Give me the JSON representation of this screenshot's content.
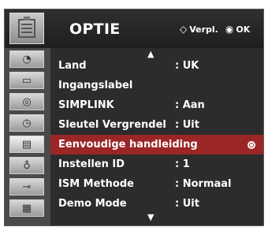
{
  "header": {
    "title": "OPTIE",
    "nav_glyph": "◇",
    "nav_label": "Verpl.",
    "ok_glyph": "◉",
    "ok_label": "OK"
  },
  "sidebar": {
    "header_icon": "option-menu-icon",
    "items": [
      {
        "icon": "satellite-dish-icon",
        "glyph": "◔"
      },
      {
        "icon": "picture-icon",
        "glyph": "▭"
      },
      {
        "icon": "audio-icon",
        "glyph": "◎"
      },
      {
        "icon": "time-icon",
        "glyph": "◷"
      },
      {
        "icon": "option-icon",
        "glyph": "▤"
      },
      {
        "icon": "lock-icon",
        "glyph": "♁"
      },
      {
        "icon": "input-icon",
        "glyph": "⊸"
      },
      {
        "icon": "usb-icon",
        "glyph": "▦"
      }
    ],
    "active_index": 4
  },
  "menu": {
    "items": [
      {
        "label": "Land",
        "value": ": UK"
      },
      {
        "label": "Ingangslabel",
        "value": ""
      },
      {
        "label": "SIMPLINK",
        "value": ": Aan"
      },
      {
        "label": "Sleutel Vergrendel",
        "value": ": Uit"
      },
      {
        "label": "Eenvoudige handleiding",
        "value": ""
      },
      {
        "label": "Instellen ID",
        "value": ": 1"
      },
      {
        "label": "ISM Methode",
        "value": ": Normaal"
      },
      {
        "label": "Demo Mode",
        "value": ": Uit"
      }
    ],
    "selected_index": 4,
    "scroll_up_glyph": "▲",
    "scroll_down_glyph": "▼"
  },
  "colors": {
    "selected_row": "#9a2626",
    "background": "#2c2c2c"
  }
}
